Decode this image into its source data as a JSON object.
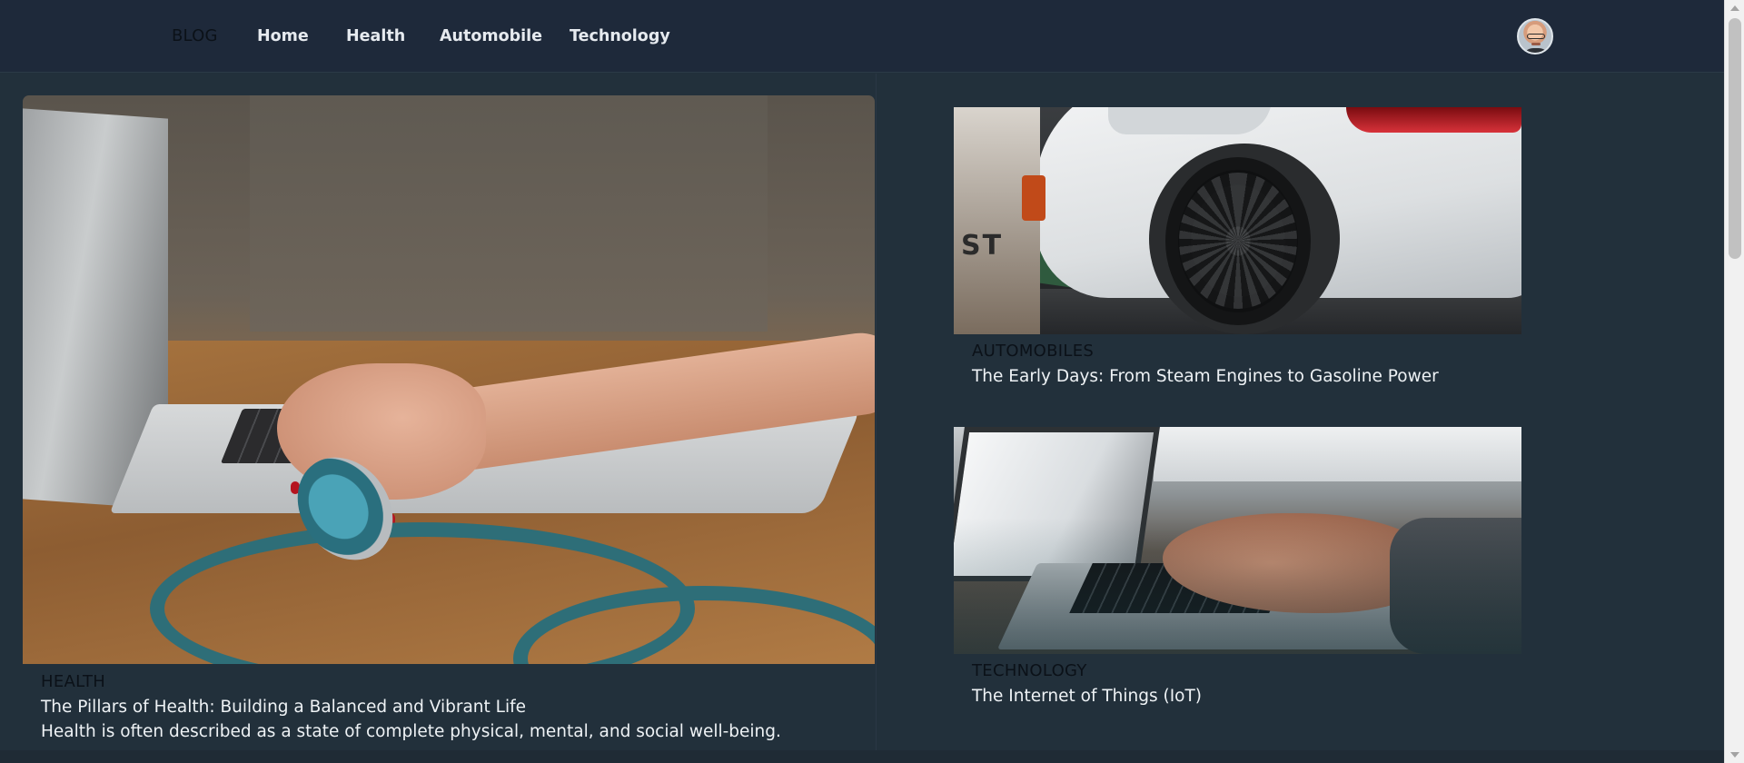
{
  "header": {
    "brand": "BLOG",
    "nav": [
      {
        "label": "Home"
      },
      {
        "label": "Health"
      },
      {
        "label": "Automobile"
      },
      {
        "label": "Technology"
      }
    ]
  },
  "featured": {
    "category": "HEALTH",
    "title": "The Pillars of Health: Building a Balanced and Vibrant Life",
    "description": "Health is often described as a state of complete physical, mental, and social well-being."
  },
  "side_posts": [
    {
      "category": "AUTOMOBILES",
      "title": "The Early Days: From Steam Engines to Gasoline Power",
      "image_text": "ST"
    },
    {
      "category": "TECHNOLOGY",
      "title": "The Internet of Things (IoT)"
    }
  ],
  "colors": {
    "background": "#22303b",
    "header": "#1e293a",
    "text_light": "#eef2f5",
    "text_dark": "#0b1118"
  },
  "icons": {
    "avatar": "user-avatar"
  }
}
